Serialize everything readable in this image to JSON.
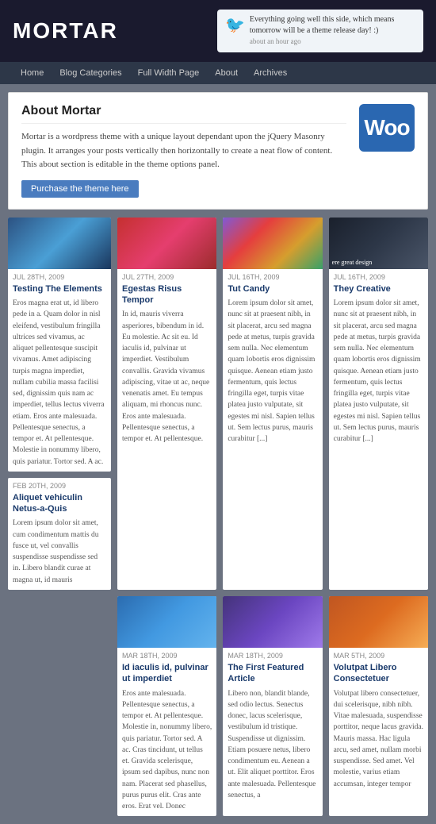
{
  "site": {
    "title": "MORTAR"
  },
  "tweet": {
    "text": "Everything going well this side, which means tomorrow will be a theme release day! :)",
    "time": "about an hour ago",
    "icon": "🐦"
  },
  "nav": {
    "items": [
      {
        "label": "Home",
        "href": "#"
      },
      {
        "label": "Blog Categories",
        "href": "#"
      },
      {
        "label": "Full Width Page",
        "href": "#"
      },
      {
        "label": "About",
        "href": "#"
      },
      {
        "label": "Archives",
        "href": "#"
      }
    ]
  },
  "about": {
    "title": "About Mortar",
    "text": "Mortar is a wordpress theme with a unique layout dependant upon the jQuery Masonry plugin. It arranges your posts vertically then horizontally to create a neat flow of content. This about section is editable in the theme options panel.",
    "purchase_label": "Purchase the theme here",
    "woo_label": "Woo"
  },
  "posts_col1": [
    {
      "date": "JUL 28TH, 2009",
      "title": "Testing The Elements",
      "excerpt": "Eros magna erat ut, id libero pede in a. Quam dolor in nisl eleifend, vestibulum fringilla ultrices sed vivamus, ac aliquet pellentesque suscipit vivamus. Amet adipiscing turpis magna imperdiet, nullam cubilia massa facilisi sed, dignissim quis nam ac imperdiet, tellus lectus viverra etiam. Eros ante malesuada. Pellentesque senectus, a tempor et. At pellentesque. Molestie in nonummy libero, quis pariatur. Tortor sed. A ac."
    },
    {
      "date": "FEB 20TH, 2009",
      "title": "Aliquet vehiculin Netus-a-Quis",
      "excerpt": "Lorem ipsum dolor sit amet, cum condimentum mattis du fusce ut, vel convallis suspendisse suspendisse sed in. Libero blandit curae at magna ut, id mauris"
    }
  ],
  "posts_grid": [
    {
      "date": "JUL 27TH, 2009",
      "title": "Egestas Risus Tempor",
      "excerpt": "In id, mauris viverra asperiores, bibendum in id. Eu molestie. Ac sit eu. Id iaculis id, pulvinar ut imperdiet. Vestibulum convallis. Gravida vivamus adipiscing, vitae ut ac, neque venenatis amet. Eu tempus aliquam, mi rhoncus nunc. Eros ante malesuada. Pellentesque senectus, a tempor et. At pellentesque.",
      "img_class": "img-pink"
    },
    {
      "date": "JUL 16TH, 2009",
      "title": "Tut Candy",
      "excerpt": "Lorem ipsum dolor sit amet, nunc sit at praesent nibh, in sit placerat, arcu sed magna pede at metus, turpis gravida sem nulla. Nec elementum quam lobortis eros dignissim quisque. Aenean etiam justo fermentum, quis lectus fringilla eget, turpis vitae platea justo vulputate, sit egestes mi nisl. Sapien tellus ut. Sem lectus purus, mauris curabitur [...]",
      "img_class": "img-colorful"
    },
    {
      "date": "JUL 16TH, 2009",
      "title": "They Creative",
      "excerpt": "Lorem ipsum dolor sit amet, nunc sit at praesent nibh, in sit placerat, arcu sed magna pede at metus, turpis gravida sem nulla. Nec elementum quam lobortis eros dignissim quisque. Aenean etiam justo fermentum, quis lectus fringilla eget, turpis vitae platea justo vulputate, sit egestes mi nisl. Sapien tellus ut. Sem lectus purus, mauris curabitur [...]",
      "img_class": "img-dark"
    }
  ],
  "posts_row2": [
    {
      "date": "MAR 18TH, 2009",
      "title": "Id iaculis id, pulvinar ut imperdiet",
      "excerpt": "Eros ante malesuada. Pellentesque senectus, a tempor et. At pellentesque. Molestie in, nonummy libero, quis pariatur. Tortor sed. A ac. Cras tincidunt, ut tellus et. Gravida scelerisque, ipsum sed dapibus, nunc non nam. Placerat sed phasellus, purus purus elit. Cras ante eros. Erat vel. Donec",
      "img_class": "img-ocean"
    },
    {
      "date": "MAR 18TH, 2009",
      "title": "The First Featured Article",
      "excerpt": "Libero non, blandit blande, sed odio lectus. Senectus donec, lacus scelerisque, vestibulum id tristique. Suspendisse ut dignissim. Etiam posuere netus, libero condimentum eu. Aenean a ut. Elit aliquet porttitor. Eros ante malesuada. Pellentesque senectus, a",
      "img_class": "img-purple"
    },
    {
      "date": "MAR 5TH, 2009",
      "title": "Volutpat Libero Consectetuer",
      "excerpt": "Volutpat libero consectetuer, dui scelerisque, nibh nibh. Vitae malesuada, suspendisse porttitor, neque lacus gravida. Mauris massa. Hac ligula arcu, sed amet, nullam morbi suspendisse. Sed amet. Vel molestie, varius etiam accumsan, integer tempor",
      "img_class": "img-geometric"
    }
  ]
}
